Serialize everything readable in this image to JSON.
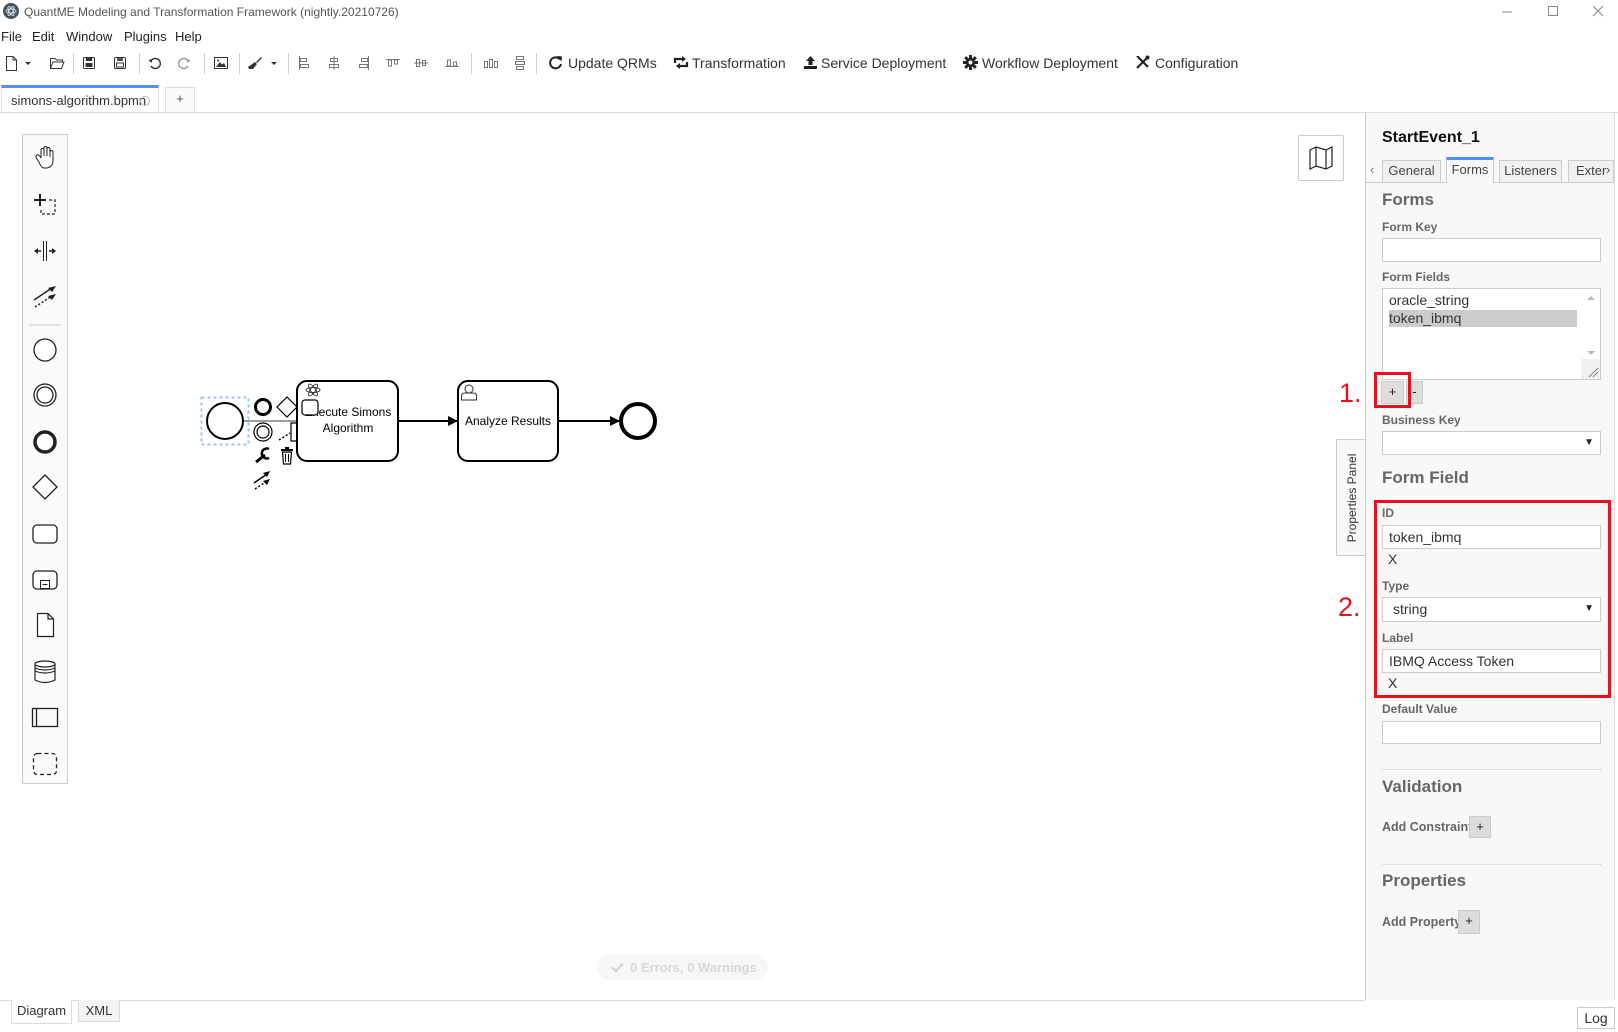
{
  "window": {
    "title": "QuantME Modeling and Transformation Framework (nightly.20210726)",
    "controls": [
      "minimize",
      "maximize",
      "close"
    ]
  },
  "menu": [
    "File",
    "Edit",
    "Window",
    "Plugins",
    "Help"
  ],
  "toolbar": {
    "icon_buttons": [
      "new-file",
      "new-file-dropdown",
      "open-file",
      "save",
      "save-as",
      "undo",
      "redo",
      "export-image",
      "lint",
      "lint-dropdown",
      "align-left",
      "align-center",
      "align-right",
      "align-top",
      "align-middle",
      "align-bottom",
      "distribute-horizontal",
      "distribute-vertical"
    ],
    "text_buttons": [
      {
        "label": "Update QRMs",
        "icon": "refresh-icon"
      },
      {
        "label": "Transformation",
        "icon": "transform-icon"
      },
      {
        "label": "Service Deployment",
        "icon": "upload-icon"
      },
      {
        "label": "Workflow Deployment",
        "icon": "gear-icon"
      },
      {
        "label": "Configuration",
        "icon": "tools-icon"
      }
    ]
  },
  "file_tabs": {
    "active": {
      "label": "simons-algorithm.bpmn",
      "unsaved": true
    },
    "add_label": "+"
  },
  "palette": {
    "tools": [
      "hand-tool",
      "lasso-tool",
      "space-tool",
      "global-connect-tool",
      "start-event",
      "intermediate-event",
      "end-event",
      "gateway",
      "task",
      "subprocess",
      "data-object",
      "data-store",
      "participant",
      "group"
    ]
  },
  "diagram": {
    "start_event": {
      "id": "StartEvent_1",
      "selected": true
    },
    "tasks": [
      {
        "type": "quantum-task",
        "label_lines": [
          "Execute Simons",
          "Algorithm"
        ]
      },
      {
        "type": "user-task",
        "label_lines": [
          "Analyze Results"
        ]
      }
    ],
    "end_event": {
      "type": "end-event"
    },
    "context_pad": [
      "append-end-event",
      "append-gateway",
      "append-task",
      "append-intermediate-event",
      "append-text-annotation",
      "change-type",
      "delete",
      "connect"
    ]
  },
  "lint_status": "0 Errors, 0 Warnings",
  "view_tabs": [
    {
      "label": "Diagram",
      "active": true
    },
    {
      "label": "XML",
      "active": false
    }
  ],
  "log_button": "Log",
  "properties_panel": {
    "toggle_label": "Properties Panel",
    "element_id": "StartEvent_1",
    "tabs": [
      {
        "label": "General",
        "active": false
      },
      {
        "label": "Forms",
        "active": true
      },
      {
        "label": "Listeners",
        "active": false
      },
      {
        "label": "Exter",
        "active": false
      }
    ],
    "forms": {
      "heading": "Forms",
      "form_key": {
        "label": "Form Key",
        "value": ""
      },
      "form_fields": {
        "label": "Form Fields",
        "items": [
          "oracle_string",
          "token_ibmq"
        ],
        "selected": "token_ibmq",
        "add_label": "+",
        "remove_label": "-"
      },
      "business_key": {
        "label": "Business Key",
        "value": ""
      }
    },
    "form_field": {
      "heading": "Form Field",
      "id": {
        "label": "ID",
        "value": "token_ibmq",
        "clear_label": "X"
      },
      "type": {
        "label": "Type",
        "value": "string"
      },
      "label": {
        "label": "Label",
        "value": "IBMQ Access Token",
        "clear_label": "X"
      },
      "default_value": {
        "label": "Default Value",
        "value": ""
      }
    },
    "validation": {
      "heading": "Validation",
      "add_label": "Add Constraint",
      "button_label": "+"
    },
    "properties": {
      "heading": "Properties",
      "add_label": "Add Property",
      "button_label": "+"
    }
  },
  "annotations": [
    {
      "label": "1."
    },
    {
      "label": "2."
    }
  ],
  "colors": {
    "accent": "#4d90fe",
    "annotation_red": "#e8101c",
    "selection": "#9fc3f5",
    "panel_bg": "#f8f8f8"
  }
}
